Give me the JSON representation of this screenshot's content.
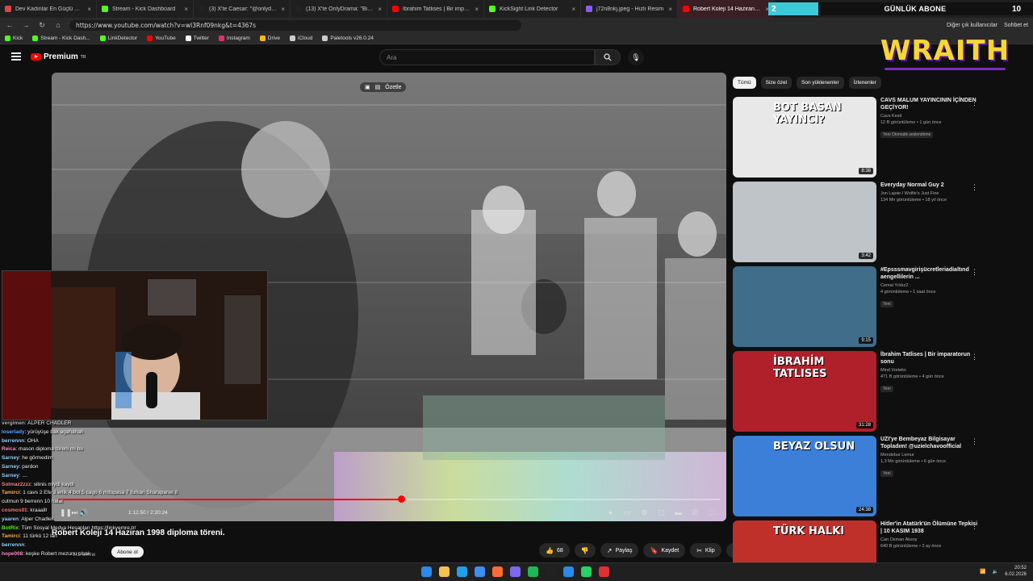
{
  "browser": {
    "tabs": [
      {
        "title": "Dev Kadınlar En Güçlü Cücelere K...",
        "color": "#e04545"
      },
      {
        "title": "Stream - Kick Dashboard",
        "color": "#53fc18"
      },
      {
        "title": "(3) X'te Caesar: \"@onlydramaX Ta...",
        "color": "#222222"
      },
      {
        "title": "(13) X'te OnlyDrama: \"BishopIRL F...",
        "color": "#222222"
      },
      {
        "title": "İbrahim Tatlises | Bir imparatorun...",
        "color": "#ff0000"
      },
      {
        "title": "KickSight Link Detector",
        "color": "#53fc18"
      },
      {
        "title": "j72n8nkj.jpeg - Hızlı Resim",
        "color": "#8a5cf6"
      },
      {
        "title": "Robert Koleji 14 Haziran 1998 dipl...",
        "color": "#ff0000"
      }
    ],
    "url": "https://www.youtube.com/watch?v=wl3Rnf09nkg&t=4367s",
    "profile_label": "Diğer çık kullanıcılar",
    "chat_label": "Sohbet et",
    "bookmarks": [
      {
        "label": "Kick",
        "color": "#53fc18"
      },
      {
        "label": "Stream - Kick Dash...",
        "color": "#53fc18"
      },
      {
        "label": "LinkDetector",
        "color": "#53fc18"
      },
      {
        "label": "YouTube",
        "color": "#ff0000"
      },
      {
        "label": "Twitter",
        "color": "#ffffff"
      },
      {
        "label": "Instagram",
        "color": "#e1306c"
      },
      {
        "label": "Drive",
        "color": "#fbbc04"
      },
      {
        "label": "iCloud",
        "color": "#cccccc"
      },
      {
        "label": "Paletools v26.0.24",
        "color": "#cccccc"
      }
    ]
  },
  "overlay": {
    "abone_left": "2",
    "abone_label": "GÜNLÜK ABONE",
    "abone_right": "10",
    "brand": "WRAITH"
  },
  "youtube": {
    "logo": "Premium",
    "logo_sup": "TR",
    "search_placeholder": "Ara",
    "summarize_label": "Özetle",
    "video": {
      "title": "Robert Koleji 14 Haziran 1998 diploma töreni.",
      "time": "1:12:50 / 2:20:24",
      "progress": 0.518,
      "views_text": "615 abone",
      "subscribe_label": "Abone ol",
      "likes": "68",
      "share": "Paylaş",
      "save": "Kaydet",
      "clip": "Klip"
    },
    "chips": [
      {
        "label": "Tümü",
        "active": true
      },
      {
        "label": "Size özel",
        "active": false
      },
      {
        "label": "Son yüklenenler",
        "active": false
      },
      {
        "label": "İzlenenler",
        "active": false
      }
    ],
    "recommendations": [
      {
        "title": "CAVS MALUM YAYINCININ İÇİNDEN GEÇİYOR!",
        "channel": "Cavs Kesit",
        "meta": "12 B görüntüleme • 1 gün önce",
        "badge": "Yeni  Otomatik seslendirme",
        "duration": "8:38",
        "thumb_text": "BOT BASAN YAYINCI?"
      },
      {
        "title": "Everyday Normal Guy 2",
        "channel": "Jon Lajoie / Wolfie's Just Fine",
        "meta": "134 Mn görüntüleme • 18 yıl önce",
        "badge": "",
        "duration": "3:42",
        "thumb_text": ""
      },
      {
        "title": "#Epsssmavgirişücretleriadialtınd aengellilerin ...",
        "channel": "Cemal Yıldız2",
        "meta": "4 görüntüleme • 1 saat önce",
        "badge": "Yeni",
        "duration": "9:15",
        "thumb_text": ""
      },
      {
        "title": "İbrahim Tatlises | Bir imparatorun sonu",
        "channel": "Mind Vorteks",
        "meta": "471 B görüntüleme • 4 gün önce",
        "badge": "Yeni",
        "duration": "31:28",
        "thumb_text": "İBRAHİM TATLISES"
      },
      {
        "title": "UZI'ye Bembeyaz Bilgisayar Topladım! @uzielchavoofficial",
        "channel": "Mendebur Lemur",
        "meta": "1,3 Mn görüntüleme • 6 gün önce",
        "badge": "Yeni",
        "duration": "24:38",
        "thumb_text": "BEYAZ OLSUN"
      },
      {
        "title": "Hitler'in Atatürk'ün Ölümüne Tepkisi | 10 KASIM 1938",
        "channel": "Can Osman Aksoy",
        "meta": "640 B görüntüleme • 2 ay önce",
        "badge": "",
        "duration": "",
        "thumb_text": "TÜRK HALKI"
      }
    ]
  },
  "chat": [
    {
      "user": "vergimen",
      "text": ": ALPER CHADLER",
      "color": "#b0b0b0"
    },
    {
      "user": "loserlady",
      "text": ": yürüyüşe bak agahahah",
      "color": "#5aa9ff"
    },
    {
      "user": "berrennn",
      "text": ": OHA",
      "color": "#8fd3ff"
    },
    {
      "user": "Reica",
      "text": ": mason diploma töreni mi bu",
      "color": "#ff8ec6"
    },
    {
      "user": "Sarney",
      "text": ": he görmedim",
      "color": "#8fd3ff"
    },
    {
      "user": "Sarney",
      "text": ": pardon",
      "color": "#8fd3ff"
    },
    {
      "user": "Sarney",
      "text": ": ....",
      "color": "#8fd3ff"
    },
    {
      "user": "Solmaz2zzz",
      "text": ": silinis miydi kaydi",
      "color": "#ff7b7b"
    },
    {
      "user": "Tamirci",
      "text": ": 1 cavs 2 Efe 3 erlik 4 bot 5 cago 6 mitopasa 7 furkan Sharapanel 8",
      "color": "#ffb347"
    },
    {
      "user": "",
      "text": "cutmun 9 berrenn 10 halat",
      "color": "#ffffff"
    },
    {
      "user": "cosmos01",
      "text": ": kraaalll",
      "color": "#ff7b7b"
    },
    {
      "user": "yaaren",
      "text": ": Alper Chadler",
      "color": "#8fd3ff"
    },
    {
      "user": "BotRix",
      "text": ": Tüm Sosyal Medya Hesapları https://linkyemre.tr/",
      "color": "#53fc18"
    },
    {
      "user": "Tamirci",
      "text": ": 11 türkü 12 lan",
      "color": "#ffb347"
    },
    {
      "user": "berrennn",
      "text": ":",
      "color": "#8fd3ff"
    },
    {
      "user": "hope008",
      "text": ": keşke Robert mezunu olsak",
      "color": "#ff8ec6"
    }
  ],
  "taskbar": {
    "time": "20:52",
    "date": "6.02.2026"
  }
}
